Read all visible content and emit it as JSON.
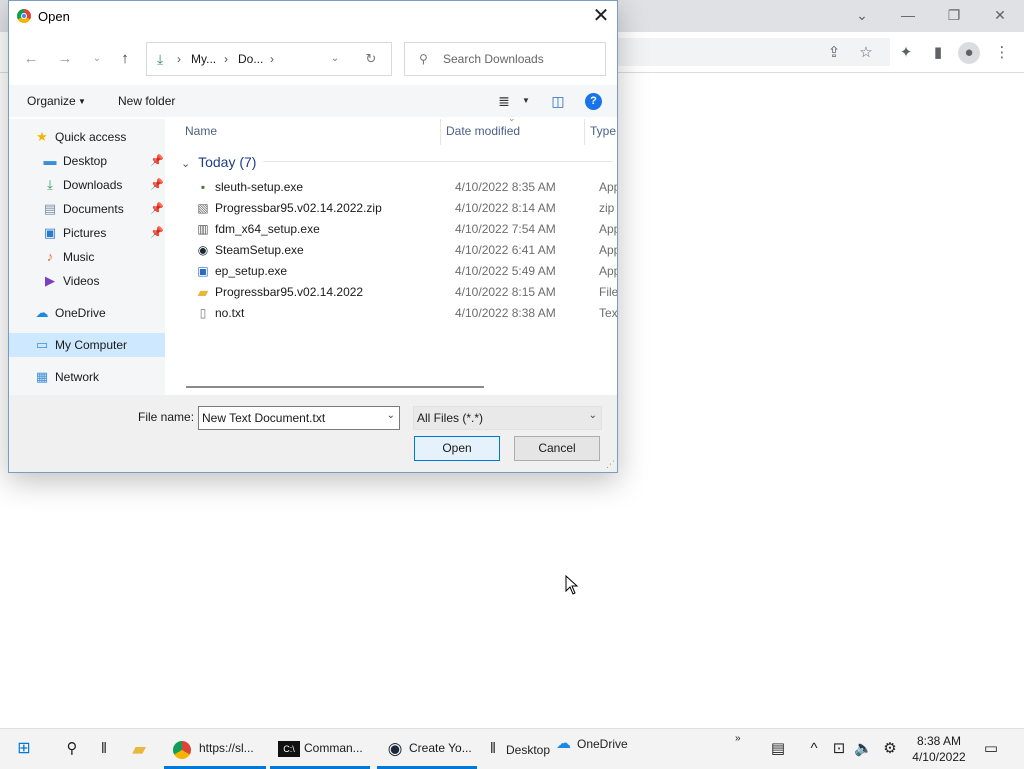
{
  "chrome": {
    "window_controls": [
      "⌄",
      "—",
      "❐",
      "✕"
    ]
  },
  "dialog": {
    "title": "Open",
    "breadcrumbs": [
      "My...",
      "Do..."
    ],
    "search_placeholder": "Search Downloads",
    "organize_label": "Organize",
    "new_folder_label": "New folder",
    "help_label": "?",
    "nav_items": [
      {
        "label": "Quick access",
        "icon": "star-icon"
      },
      {
        "label": "Desktop",
        "icon": "desktop-icon",
        "pinned": true
      },
      {
        "label": "Downloads",
        "icon": "downloads-icon",
        "pinned": true
      },
      {
        "label": "Documents",
        "icon": "documents-icon",
        "pinned": true
      },
      {
        "label": "Pictures",
        "icon": "pictures-icon",
        "pinned": true
      },
      {
        "label": "Music",
        "icon": "music-icon"
      },
      {
        "label": "Videos",
        "icon": "videos-icon"
      },
      {
        "label": "OneDrive",
        "icon": "cloud-icon"
      },
      {
        "label": "My Computer",
        "icon": "computer-icon",
        "selected": true
      },
      {
        "label": "Network",
        "icon": "network-icon"
      }
    ],
    "columns": {
      "name": "Name",
      "date": "Date modified",
      "type": "Type"
    },
    "group_label": "Today (7)",
    "files": [
      {
        "name": "sleuth-setup.exe",
        "date": "4/10/2022 8:35 AM",
        "type": "Appli",
        "icon": "installer-icon"
      },
      {
        "name": "Progressbar95.v02.14.2022.zip",
        "date": "4/10/2022 8:14 AM",
        "type": "zip A",
        "icon": "zip-icon"
      },
      {
        "name": "fdm_x64_setup.exe",
        "date": "4/10/2022 7:54 AM",
        "type": "Appli",
        "icon": "installer-icon"
      },
      {
        "name": "SteamSetup.exe",
        "date": "4/10/2022 6:41 AM",
        "type": "Appli",
        "icon": "steam-icon"
      },
      {
        "name": "ep_setup.exe",
        "date": "4/10/2022 5:49 AM",
        "type": "Appli",
        "icon": "app-icon"
      },
      {
        "name": "Progressbar95.v02.14.2022",
        "date": "4/10/2022 8:15 AM",
        "type": "File fo",
        "icon": "folder-icon"
      },
      {
        "name": "no.txt",
        "date": "4/10/2022 8:38 AM",
        "type": "Text D",
        "icon": "text-file-icon"
      }
    ],
    "file_name_label": "File name:",
    "file_name_value": "New Text Document.txt",
    "filter_value": "All Files (*.*)",
    "open_button": "Open",
    "cancel_button": "Cancel"
  },
  "taskbar": {
    "apps": [
      {
        "label": "https://sl...",
        "icon": "chrome-icon"
      },
      {
        "label": "Comman...",
        "icon": "terminal-icon"
      },
      {
        "label": "Create Yo...",
        "icon": "steam-icon"
      }
    ],
    "desktop_label": "Desktop",
    "onedrive_label": "OneDrive",
    "time": "8:38 AM",
    "date": "4/10/2022"
  },
  "colors": {
    "accent": "#0078d7",
    "selected": "#cde8ff",
    "link_blue": "#1e3e86"
  }
}
